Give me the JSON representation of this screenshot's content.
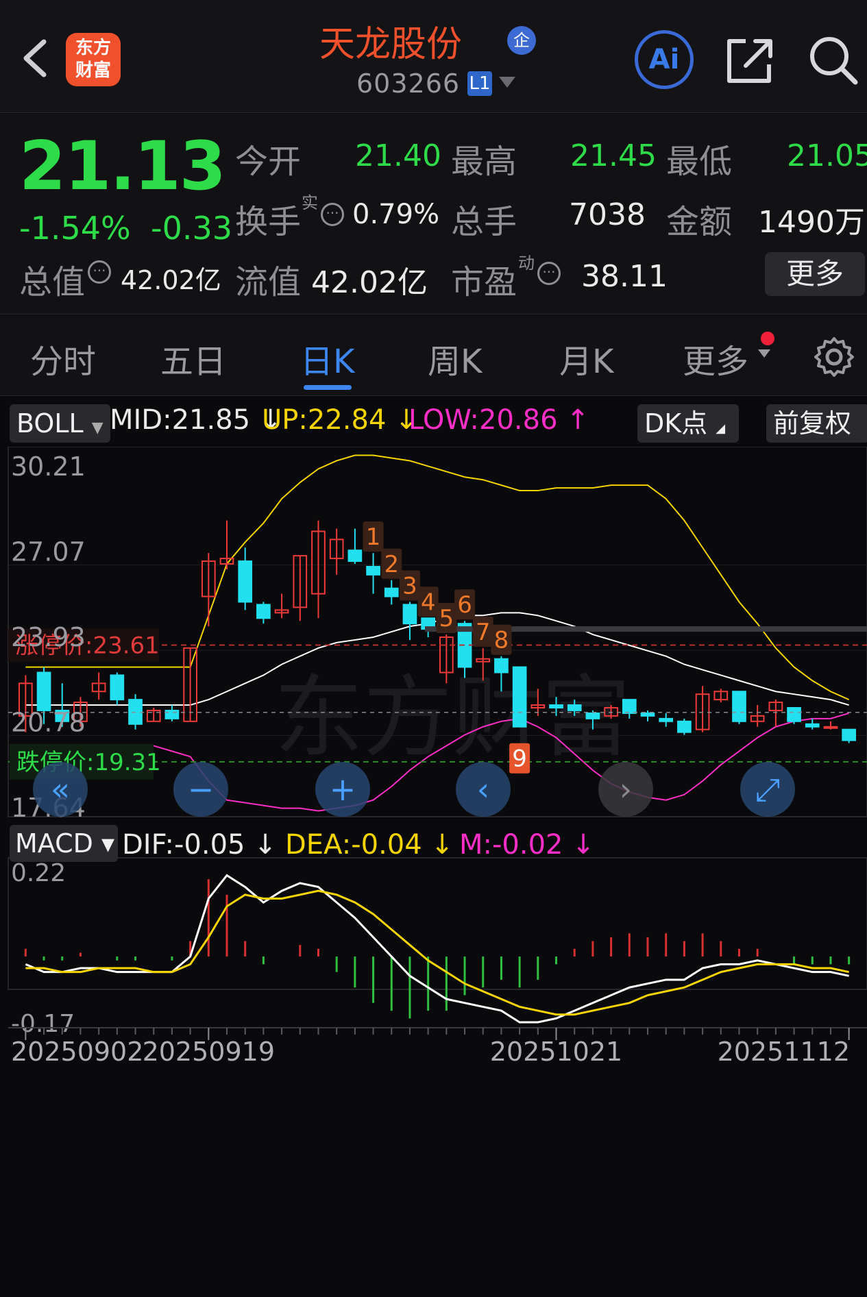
{
  "header": {
    "logo_line1": "东方",
    "logo_line2": "财富",
    "stock_name": "天龙股份",
    "badge": "企",
    "stock_code": "603266",
    "market_badge": "L1",
    "ai_label": "Ai"
  },
  "quote": {
    "price": "21.13",
    "change_pct": "-1.54%",
    "change": "-0.33",
    "open_label": "今开",
    "open": "21.40",
    "high_label": "最高",
    "high": "21.45",
    "low_label": "最低",
    "low": "21.05",
    "turnover_label": "换手",
    "turnover_sup": "实",
    "turnover": "0.79%",
    "volume_label": "总手",
    "volume": "7038",
    "amount_label": "金额",
    "amount": "1490万",
    "mktcap_label": "总值",
    "mktcap": "42.02亿",
    "float_label": "流值",
    "float": "42.02亿",
    "pe_label": "市盈",
    "pe_sup": "动",
    "pe": "38.11",
    "more_button": "更多"
  },
  "tabs": [
    "分时",
    "五日",
    "日K",
    "周K",
    "月K",
    "更多"
  ],
  "active_tab": "日K",
  "indicator_bar": {
    "main": "BOLL",
    "mid": "MID:21.85",
    "up": "UP:22.84",
    "low": "LOW:20.86",
    "dk": "DK点",
    "adjust": "前复权",
    "up_color": "#f5d400",
    "low_color": "#ff2ec8"
  },
  "sub_indicator_bar": {
    "name": "MACD",
    "dif": "DIF:-0.05",
    "dea": "DEA:-0.04",
    "m": "M:-0.02"
  },
  "chart_data": [
    {
      "type": "candlestick",
      "title": "",
      "y_ticks": [
        "30.21",
        "27.07",
        "23.93",
        "20.78",
        "17.64"
      ],
      "ylim": [
        17.64,
        30.21
      ],
      "limit_up_label": "涨停价:23.61",
      "limit_up": 23.61,
      "limit_down_label": "跌停价:19.31",
      "limit_down": 19.31,
      "current_price": 21.13,
      "candles": [
        {
          "o": 21.0,
          "c": 22.2,
          "h": 22.5,
          "l": 20.4
        },
        {
          "o": 22.6,
          "c": 21.2,
          "h": 22.8,
          "l": 20.7
        },
        {
          "o": 21.2,
          "c": 20.8,
          "h": 22.2,
          "l": 20.6
        },
        {
          "o": 20.8,
          "c": 21.5,
          "h": 21.7,
          "l": 20.6
        },
        {
          "o": 21.9,
          "c": 22.2,
          "h": 22.6,
          "l": 21.6
        },
        {
          "o": 22.5,
          "c": 21.6,
          "h": 22.6,
          "l": 21.4
        },
        {
          "o": 21.6,
          "c": 20.7,
          "h": 21.8,
          "l": 20.5
        },
        {
          "o": 20.8,
          "c": 21.2,
          "h": 21.3,
          "l": 20.8
        },
        {
          "o": 21.2,
          "c": 20.9,
          "h": 21.4,
          "l": 20.8
        },
        {
          "o": 20.8,
          "c": 23.5,
          "h": 23.5,
          "l": 20.8
        },
        {
          "o": 25.4,
          "c": 26.7,
          "h": 27.0,
          "l": 24.3
        },
        {
          "o": 26.6,
          "c": 26.8,
          "h": 28.2,
          "l": 26.4
        },
        {
          "o": 26.7,
          "c": 25.2,
          "h": 27.2,
          "l": 24.9
        },
        {
          "o": 25.1,
          "c": 24.6,
          "h": 25.2,
          "l": 24.4
        },
        {
          "o": 24.8,
          "c": 24.9,
          "h": 25.5,
          "l": 24.6
        },
        {
          "o": 25.0,
          "c": 26.9,
          "h": 26.9,
          "l": 24.5
        },
        {
          "o": 25.5,
          "c": 27.8,
          "h": 28.2,
          "l": 24.6
        },
        {
          "o": 26.8,
          "c": 27.5,
          "h": 27.9,
          "l": 26.2
        },
        {
          "o": 27.1,
          "c": 26.7,
          "h": 27.9,
          "l": 26.6
        },
        {
          "o": 26.5,
          "c": 26.2,
          "h": 27.0,
          "l": 25.5
        },
        {
          "o": 25.7,
          "c": 25.4,
          "h": 26.0,
          "l": 25.1
        },
        {
          "o": 25.1,
          "c": 24.4,
          "h": 25.2,
          "l": 23.8
        },
        {
          "o": 24.6,
          "c": 24.2,
          "h": 24.6,
          "l": 23.9
        },
        {
          "o": 22.6,
          "c": 23.9,
          "h": 24.0,
          "l": 22.2
        },
        {
          "o": 24.4,
          "c": 22.8,
          "h": 24.5,
          "l": 22.4
        },
        {
          "o": 23.0,
          "c": 23.1,
          "h": 23.5,
          "l": 22.3
        },
        {
          "o": 23.1,
          "c": 22.6,
          "h": 23.2,
          "l": 21.9
        },
        {
          "o": 22.8,
          "c": 20.6,
          "h": 22.8,
          "l": 20.6
        },
        {
          "o": 21.3,
          "c": 21.4,
          "h": 22.0,
          "l": 21.0
        },
        {
          "o": 21.4,
          "c": 21.3,
          "h": 21.7,
          "l": 21.0
        },
        {
          "o": 21.4,
          "c": 21.2,
          "h": 21.6,
          "l": 21.0
        },
        {
          "o": 21.1,
          "c": 20.9,
          "h": 21.2,
          "l": 20.5
        },
        {
          "o": 21.0,
          "c": 21.3,
          "h": 21.4,
          "l": 20.9
        },
        {
          "o": 21.6,
          "c": 21.1,
          "h": 21.6,
          "l": 20.9
        },
        {
          "o": 21.1,
          "c": 21.0,
          "h": 21.2,
          "l": 20.8
        },
        {
          "o": 20.9,
          "c": 20.8,
          "h": 21.1,
          "l": 20.6
        },
        {
          "o": 20.8,
          "c": 20.4,
          "h": 20.9,
          "l": 20.3
        },
        {
          "o": 20.5,
          "c": 21.8,
          "h": 22.1,
          "l": 20.4
        },
        {
          "o": 21.6,
          "c": 21.9,
          "h": 22.0,
          "l": 21.5
        },
        {
          "o": 21.9,
          "c": 20.8,
          "h": 21.9,
          "l": 20.7
        },
        {
          "o": 20.8,
          "c": 21.0,
          "h": 21.4,
          "l": 20.6
        },
        {
          "o": 21.2,
          "c": 21.5,
          "h": 21.6,
          "l": 20.6
        },
        {
          "o": 21.3,
          "c": 20.8,
          "h": 21.3,
          "l": 20.7
        },
        {
          "o": 20.7,
          "c": 20.6,
          "h": 20.9,
          "l": 20.5
        },
        {
          "o": 20.6,
          "c": 20.6,
          "h": 20.8,
          "l": 20.5
        },
        {
          "o": 20.5,
          "c": 20.1,
          "h": 20.5,
          "l": 20.0
        }
      ],
      "boll_up": [
        22.8,
        22.8,
        22.8,
        22.8,
        22.8,
        22.8,
        22.8,
        22.8,
        22.8,
        22.8,
        24.7,
        26.6,
        27.4,
        28.1,
        29.0,
        29.6,
        30.1,
        30.4,
        30.6,
        30.6,
        30.5,
        30.4,
        30.2,
        30.0,
        29.8,
        29.7,
        29.5,
        29.3,
        29.3,
        29.4,
        29.4,
        29.4,
        29.5,
        29.5,
        29.5,
        29.0,
        28.2,
        27.2,
        26.2,
        25.2,
        24.4,
        23.5,
        22.8,
        22.3,
        21.9,
        21.6
      ],
      "boll_mid": [
        21.4,
        21.4,
        21.4,
        21.4,
        21.4,
        21.4,
        21.4,
        21.4,
        21.4,
        21.4,
        21.6,
        21.9,
        22.2,
        22.5,
        22.9,
        23.2,
        23.5,
        23.7,
        23.8,
        23.9,
        24.1,
        24.3,
        24.4,
        24.6,
        24.7,
        24.7,
        24.8,
        24.8,
        24.7,
        24.5,
        24.3,
        24.0,
        23.8,
        23.6,
        23.4,
        23.2,
        22.9,
        22.7,
        22.5,
        22.3,
        22.1,
        21.9,
        21.8,
        21.7,
        21.6,
        21.4
      ],
      "boll_low": [
        19.9,
        19.9,
        19.9,
        19.8,
        19.7,
        19.7,
        19.9,
        19.9,
        19.7,
        19.5,
        18.6,
        17.9,
        17.8,
        17.7,
        17.6,
        17.6,
        17.5,
        17.6,
        17.7,
        17.9,
        18.4,
        19.0,
        19.5,
        19.9,
        20.3,
        20.6,
        20.8,
        20.9,
        20.6,
        20.2,
        19.6,
        19.0,
        18.5,
        18.2,
        18.0,
        17.9,
        18.1,
        18.6,
        19.2,
        19.7,
        20.2,
        20.6,
        20.8,
        20.9,
        20.9,
        21.1
      ],
      "signals": [
        {
          "i": 19,
          "label": "1"
        },
        {
          "i": 20,
          "label": "2"
        },
        {
          "i": 21,
          "label": "3"
        },
        {
          "i": 22,
          "label": "4"
        },
        {
          "i": 23,
          "label": "5"
        },
        {
          "i": 24,
          "label": "6"
        },
        {
          "i": 25,
          "label": "7"
        },
        {
          "i": 26,
          "label": "8"
        },
        {
          "i": 27,
          "label": "9"
        }
      ]
    },
    {
      "type": "macd",
      "title": "",
      "y_ticks": [
        "0.22",
        "-0.17"
      ],
      "ylim": [
        -0.17,
        0.22
      ],
      "x_ticks": [
        {
          "i": 0,
          "label": "20250902"
        },
        {
          "i": 10,
          "label": "20250919"
        },
        {
          "i": 29,
          "label": "20251021"
        },
        {
          "i": 45,
          "label": "20251112"
        }
      ],
      "dif": [
        -0.02,
        -0.04,
        -0.04,
        -0.03,
        -0.03,
        -0.04,
        -0.04,
        -0.04,
        -0.04,
        0.0,
        0.15,
        0.21,
        0.18,
        0.14,
        0.17,
        0.19,
        0.18,
        0.14,
        0.1,
        0.05,
        0.0,
        -0.05,
        -0.08,
        -0.11,
        -0.12,
        -0.13,
        -0.14,
        -0.17,
        -0.17,
        -0.16,
        -0.14,
        -0.12,
        -0.1,
        -0.08,
        -0.07,
        -0.06,
        -0.06,
        -0.03,
        -0.02,
        -0.02,
        -0.01,
        -0.02,
        -0.03,
        -0.04,
        -0.04,
        -0.05
      ],
      "dea": [
        -0.03,
        -0.03,
        -0.04,
        -0.04,
        -0.03,
        -0.03,
        -0.03,
        -0.04,
        -0.04,
        -0.02,
        0.05,
        0.13,
        0.16,
        0.15,
        0.15,
        0.16,
        0.17,
        0.16,
        0.14,
        0.11,
        0.07,
        0.03,
        -0.01,
        -0.04,
        -0.07,
        -0.09,
        -0.11,
        -0.13,
        -0.14,
        -0.15,
        -0.15,
        -0.14,
        -0.13,
        -0.12,
        -0.1,
        -0.09,
        -0.08,
        -0.06,
        -0.04,
        -0.03,
        -0.02,
        -0.02,
        -0.02,
        -0.03,
        -0.03,
        -0.04
      ],
      "macd": [
        0.02,
        -0.01,
        -0.01,
        0.01,
        0.0,
        -0.01,
        -0.01,
        0.0,
        -0.01,
        0.04,
        0.2,
        0.16,
        0.04,
        -0.02,
        0.0,
        0.03,
        0.02,
        -0.04,
        -0.08,
        -0.12,
        -0.14,
        -0.16,
        -0.14,
        -0.14,
        -0.1,
        -0.08,
        -0.06,
        -0.08,
        -0.06,
        -0.02,
        0.02,
        0.04,
        0.05,
        0.06,
        0.05,
        0.06,
        0.04,
        0.06,
        0.04,
        0.02,
        0.02,
        0.0,
        -0.02,
        -0.02,
        -0.02,
        -0.02
      ]
    }
  ],
  "colors": {
    "up": "#ef3a3a",
    "down": "#22e0f0",
    "green": "#2edc4a",
    "mid_line": "#ffffff",
    "up_line": "#f5d400",
    "low_line": "#ff2ec8",
    "brand": "#f0512c",
    "accent": "#3d86f0"
  },
  "chart_controls": [
    "double-left-icon",
    "zoom-out-icon",
    "zoom-in-icon",
    "prev-icon",
    "next-icon",
    "fullscreen-icon"
  ]
}
